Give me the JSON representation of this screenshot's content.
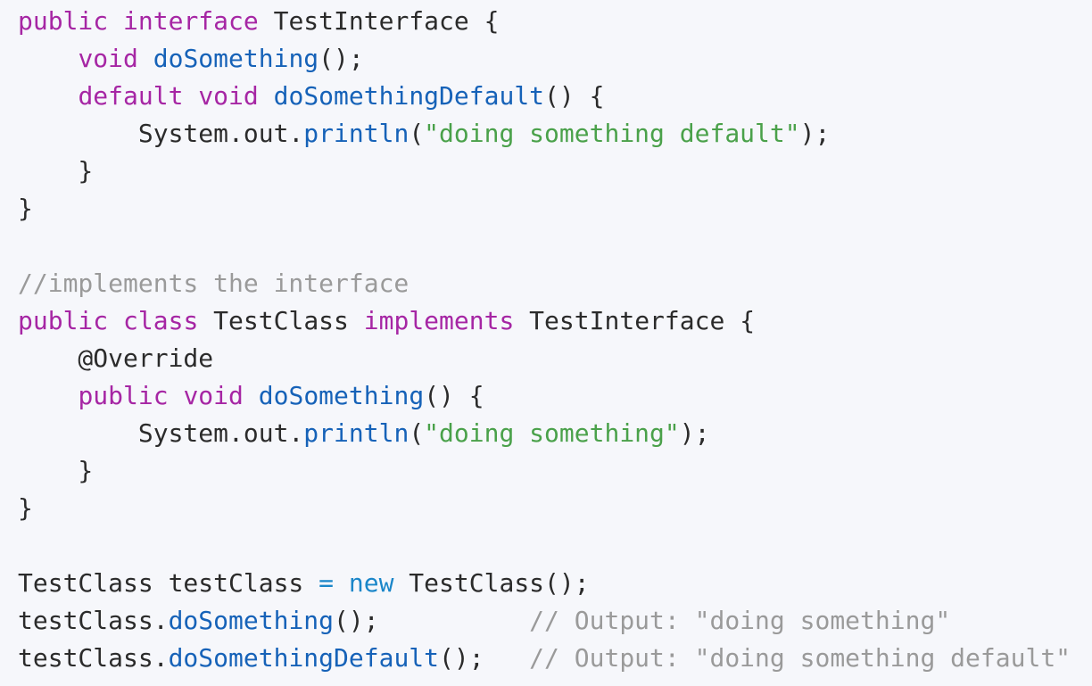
{
  "theme": {
    "background": "#f6f7fb",
    "plain": "#2b2b2b",
    "keyword": "#a626a4",
    "function": "#1662b8",
    "string": "#4aa14a",
    "comment": "#9a9a9a",
    "operator": "#1a86c9"
  },
  "code": {
    "lines": [
      [
        [
          "kw",
          "public"
        ],
        [
          "plain",
          " "
        ],
        [
          "kw",
          "interface"
        ],
        [
          "plain",
          " TestInterface {"
        ]
      ],
      [
        [
          "plain",
          "    "
        ],
        [
          "kw",
          "void"
        ],
        [
          "plain",
          " "
        ],
        [
          "fn",
          "doSomething"
        ],
        [
          "plain",
          "();"
        ]
      ],
      [
        [
          "plain",
          "    "
        ],
        [
          "kw",
          "default"
        ],
        [
          "plain",
          " "
        ],
        [
          "kw",
          "void"
        ],
        [
          "plain",
          " "
        ],
        [
          "fn",
          "doSomethingDefault"
        ],
        [
          "plain",
          "() {"
        ]
      ],
      [
        [
          "plain",
          "        System.out."
        ],
        [
          "fn",
          "println"
        ],
        [
          "plain",
          "("
        ],
        [
          "str",
          "\"doing something default\""
        ],
        [
          "plain",
          ");"
        ]
      ],
      [
        [
          "plain",
          "    }"
        ]
      ],
      [
        [
          "plain",
          "}"
        ]
      ],
      [],
      [
        [
          "com",
          "//implements the interface"
        ]
      ],
      [
        [
          "kw",
          "public"
        ],
        [
          "plain",
          " "
        ],
        [
          "kw",
          "class"
        ],
        [
          "plain",
          " TestClass "
        ],
        [
          "kw",
          "implements"
        ],
        [
          "plain",
          " TestInterface {"
        ]
      ],
      [
        [
          "plain",
          "    @Override"
        ]
      ],
      [
        [
          "plain",
          "    "
        ],
        [
          "kw",
          "public"
        ],
        [
          "plain",
          " "
        ],
        [
          "kw",
          "void"
        ],
        [
          "plain",
          " "
        ],
        [
          "fn",
          "doSomething"
        ],
        [
          "plain",
          "() {"
        ]
      ],
      [
        [
          "plain",
          "        System.out."
        ],
        [
          "fn",
          "println"
        ],
        [
          "plain",
          "("
        ],
        [
          "str",
          "\"doing something\""
        ],
        [
          "plain",
          ");"
        ]
      ],
      [
        [
          "plain",
          "    }"
        ]
      ],
      [
        [
          "plain",
          "}"
        ]
      ],
      [],
      [
        [
          "plain",
          "TestClass testClass "
        ],
        [
          "op",
          "="
        ],
        [
          "plain",
          " "
        ],
        [
          "op",
          "new"
        ],
        [
          "plain",
          " TestClass();"
        ]
      ],
      [
        [
          "plain",
          "testClass."
        ],
        [
          "fn",
          "doSomething"
        ],
        [
          "plain",
          "();          "
        ],
        [
          "com",
          "// Output: \"doing something\""
        ]
      ],
      [
        [
          "plain",
          "testClass."
        ],
        [
          "fn",
          "doSomethingDefault"
        ],
        [
          "plain",
          "();   "
        ],
        [
          "com",
          "// Output: \"doing something default\""
        ]
      ]
    ]
  }
}
